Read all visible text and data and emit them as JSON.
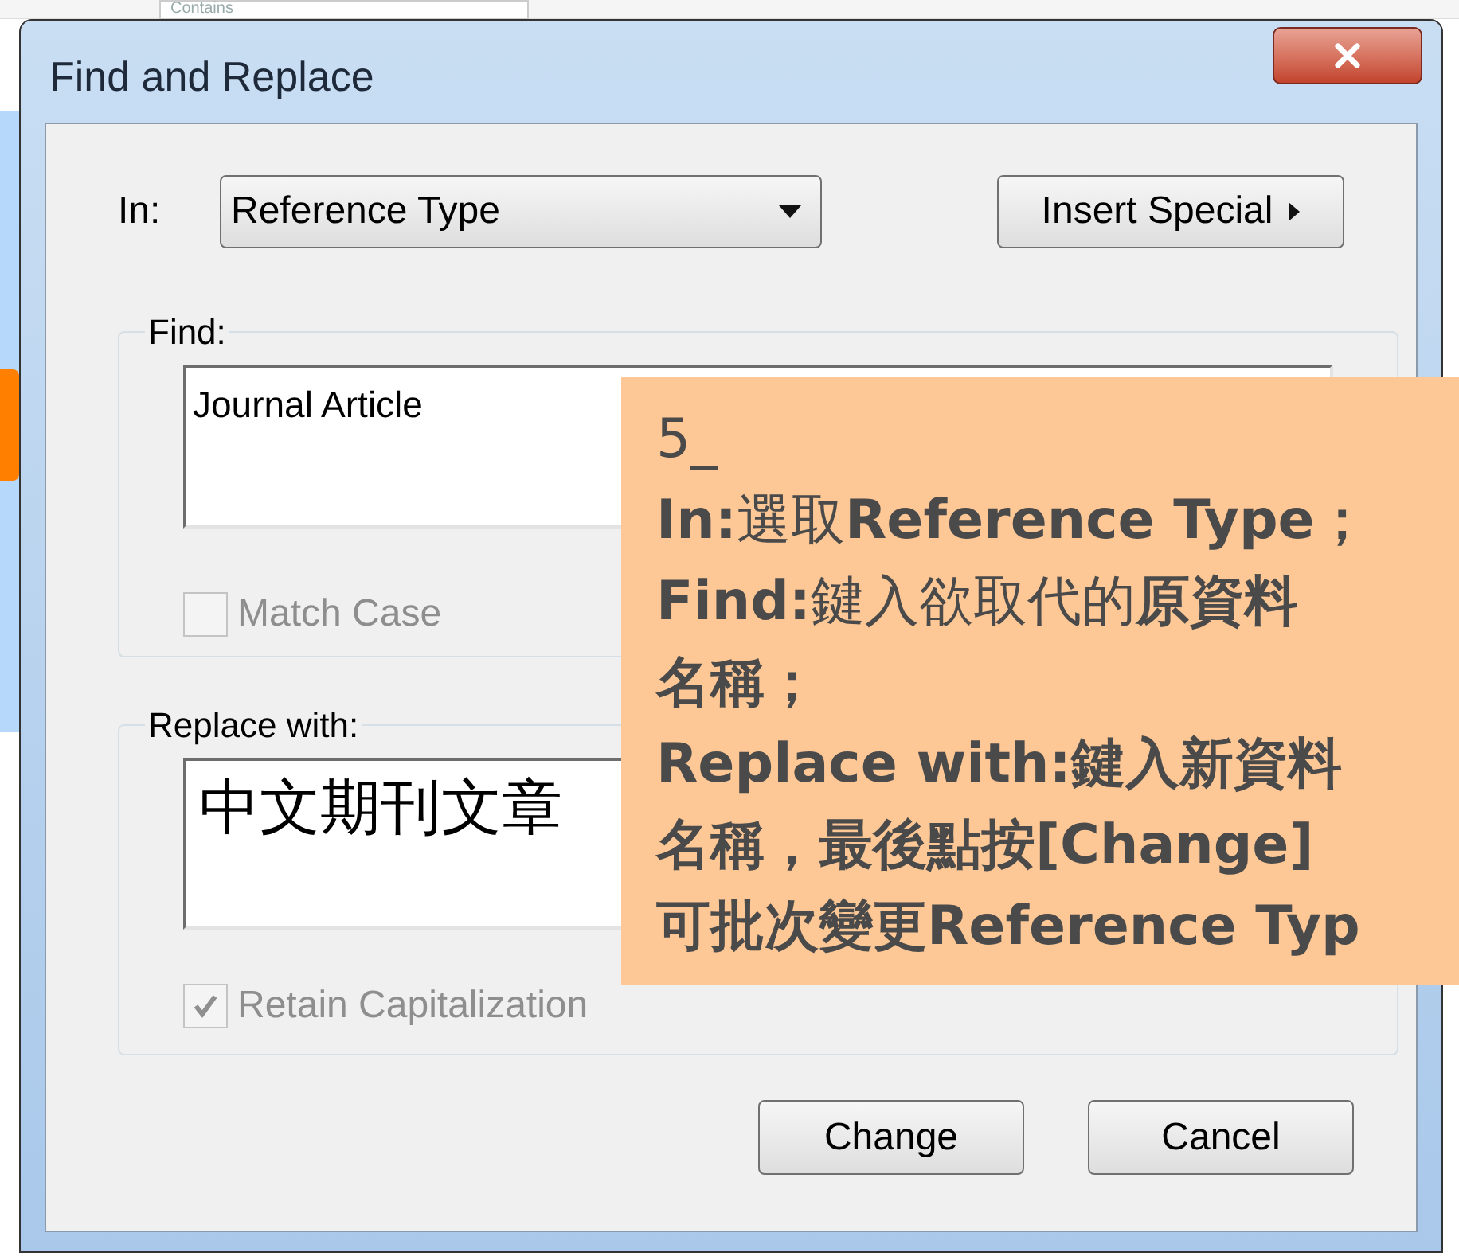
{
  "background": {
    "filter_field": "Contains"
  },
  "window": {
    "title": "Find and Replace"
  },
  "in_field": {
    "label": "In:",
    "value": "Reference Type"
  },
  "insert_special": {
    "label": "Insert Special"
  },
  "find": {
    "label": "Find:",
    "value": "Journal Article",
    "match_case": {
      "label": "Match Case",
      "checked": false,
      "disabled": true
    }
  },
  "replace": {
    "label": "Replace with:",
    "value": "中文期刊文章",
    "retain_capitalization": {
      "label": "Retain Capitalization",
      "checked": true,
      "disabled": true
    }
  },
  "buttons": [
    "Change",
    "Cancel"
  ],
  "callout": {
    "lines": [
      "5_",
      "**In:**選取**Reference Type；**",
      "**Find:**鍵入欲取代的**原資料**",
      "**名稱；**",
      "**Replace with:鍵入新資料**",
      "**名稱，最後點按[Change]**",
      "**可批次變更Reference Typ**"
    ]
  }
}
